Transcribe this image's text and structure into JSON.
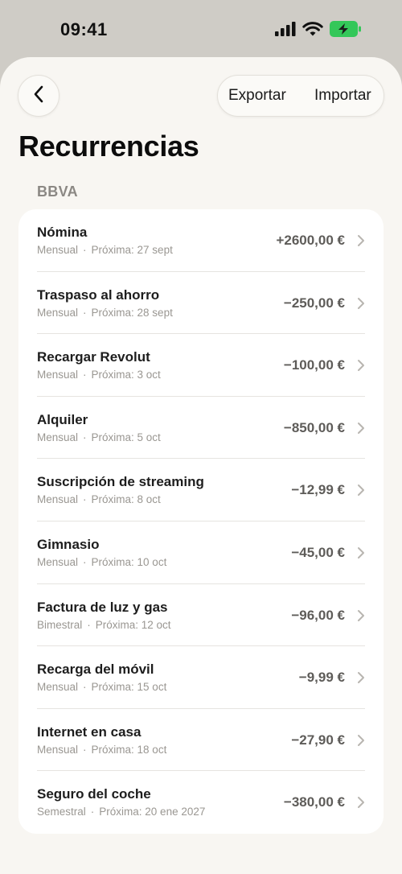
{
  "status_bar": {
    "time": "09:41",
    "icons": [
      "signal-icon",
      "wifi-icon",
      "battery-charging-icon"
    ],
    "battery_color": "#34c759"
  },
  "header": {
    "back_icon": "chevron-left-icon",
    "export_label": "Exportar",
    "import_label": "Importar"
  },
  "title": "Recurrencias",
  "section": "BBVA",
  "items": [
    {
      "name": "Nómina",
      "frequency": "Mensual",
      "next": "Próxima: 27 sept",
      "amount": "+2600,00 €"
    },
    {
      "name": "Traspaso al ahorro",
      "frequency": "Mensual",
      "next": "Próxima: 28 sept",
      "amount": "−250,00 €"
    },
    {
      "name": "Recargar Revolut",
      "frequency": "Mensual",
      "next": "Próxima: 3 oct",
      "amount": "−100,00 €"
    },
    {
      "name": "Alquiler",
      "frequency": "Mensual",
      "next": "Próxima: 5 oct",
      "amount": "−850,00 €"
    },
    {
      "name": "Suscripción de streaming",
      "frequency": "Mensual",
      "next": "Próxima: 8 oct",
      "amount": "−12,99 €"
    },
    {
      "name": "Gimnasio",
      "frequency": "Mensual",
      "next": "Próxima: 10 oct",
      "amount": "−45,00 €"
    },
    {
      "name": "Factura de luz y gas",
      "frequency": "Bimestral",
      "next": "Próxima: 12 oct",
      "amount": "−96,00 €"
    },
    {
      "name": "Recarga del móvil",
      "frequency": "Mensual",
      "next": "Próxima: 15 oct",
      "amount": "−9,99 €"
    },
    {
      "name": "Internet en casa",
      "frequency": "Mensual",
      "next": "Próxima: 18 oct",
      "amount": "−27,90 €"
    },
    {
      "name": "Seguro del coche",
      "frequency": "Semestral",
      "next": "Próxima: 20 ene 2027",
      "amount": "−380,00 €"
    }
  ]
}
